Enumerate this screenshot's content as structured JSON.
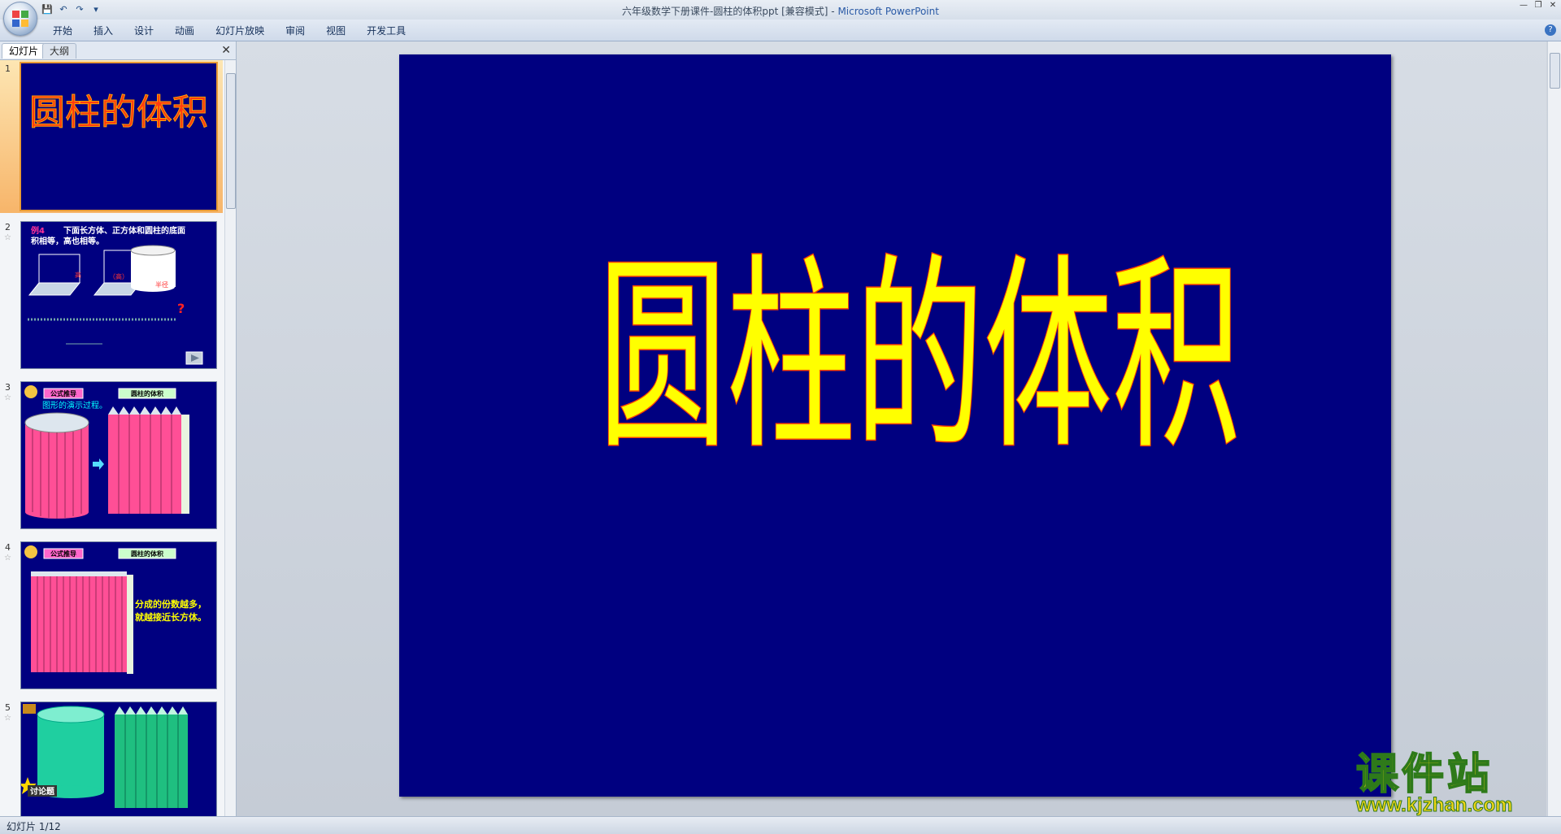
{
  "window": {
    "title_doc": "六年级数学下册课件-圆柱的体积ppt [兼容模式]",
    "title_sep": " - ",
    "title_app": "Microsoft PowerPoint"
  },
  "ribbon": {
    "tabs": [
      "开始",
      "插入",
      "设计",
      "动画",
      "幻灯片放映",
      "审阅",
      "视图",
      "开发工具"
    ]
  },
  "left_panel": {
    "tab_slides": "幻灯片",
    "tab_outline": "大纲",
    "thumbnails": [
      {
        "num": "1",
        "title": "圆柱的体积"
      },
      {
        "num": "2",
        "line1": "例4",
        "line2": "下面长方体、正方体和圆柱的底面",
        "line3": "积相等，高也相等。",
        "label_a": "高",
        "label_b": "（高）",
        "label_c": "半径",
        "q": "?"
      },
      {
        "num": "3",
        "badge1": "公式推导",
        "badge2": "圆柱的体积",
        "caption": "图形的演示过程。"
      },
      {
        "num": "4",
        "badge1": "公式推导",
        "badge2": "圆柱的体积",
        "caption1": "分成的份数越多，",
        "caption2": "就越接近长方体。"
      },
      {
        "num": "5",
        "badge": "讨论题"
      }
    ]
  },
  "slide": {
    "title": "圆柱的体积"
  },
  "status": {
    "text": "幻灯片 1/12"
  },
  "watermark": {
    "cn": "课件站",
    "url": "www.kjzhan.com"
  },
  "colors": {
    "slide_bg": "#000080",
    "title_fill": "#ffff00",
    "title_stroke": "#ff4000",
    "selection": "#f7b56a"
  }
}
